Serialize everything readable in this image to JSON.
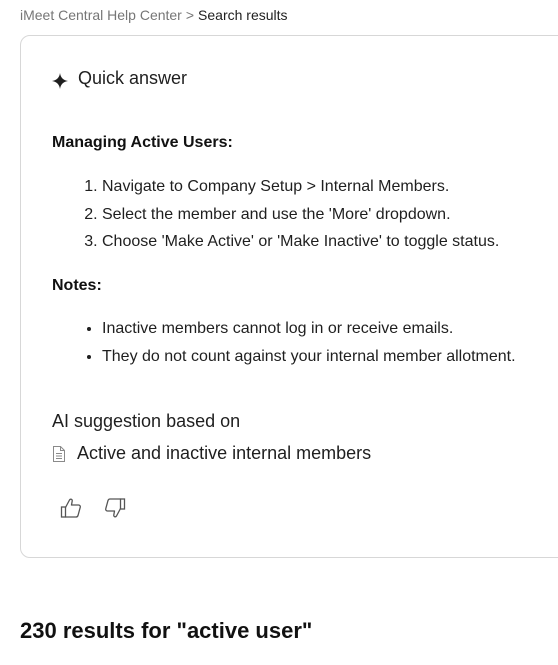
{
  "breadcrumb": {
    "home_label": "iMeet Central Help Center",
    "separator": ">",
    "current_label": "Search results"
  },
  "quick_answer": {
    "title": "Quick answer",
    "icon": "sparkle-icon",
    "section1_title": "Managing Active Users:",
    "steps": [
      "Navigate to Company Setup > Internal Members.",
      "Select the member and use the 'More' dropdown.",
      "Choose 'Make Active' or 'Make Inactive' to toggle status."
    ],
    "section2_title": "Notes:",
    "notes": [
      "Inactive members cannot log in or receive emails.",
      "They do not count against your internal member allotment."
    ],
    "ai_suggestion_label": "AI suggestion based on",
    "source": {
      "icon": "document-icon",
      "title": "Active and inactive internal members"
    },
    "feedback": {
      "like_icon": "thumbs-up-icon",
      "dislike_icon": "thumbs-down-icon"
    }
  },
  "results": {
    "heading": "230 results for \"active user\""
  }
}
